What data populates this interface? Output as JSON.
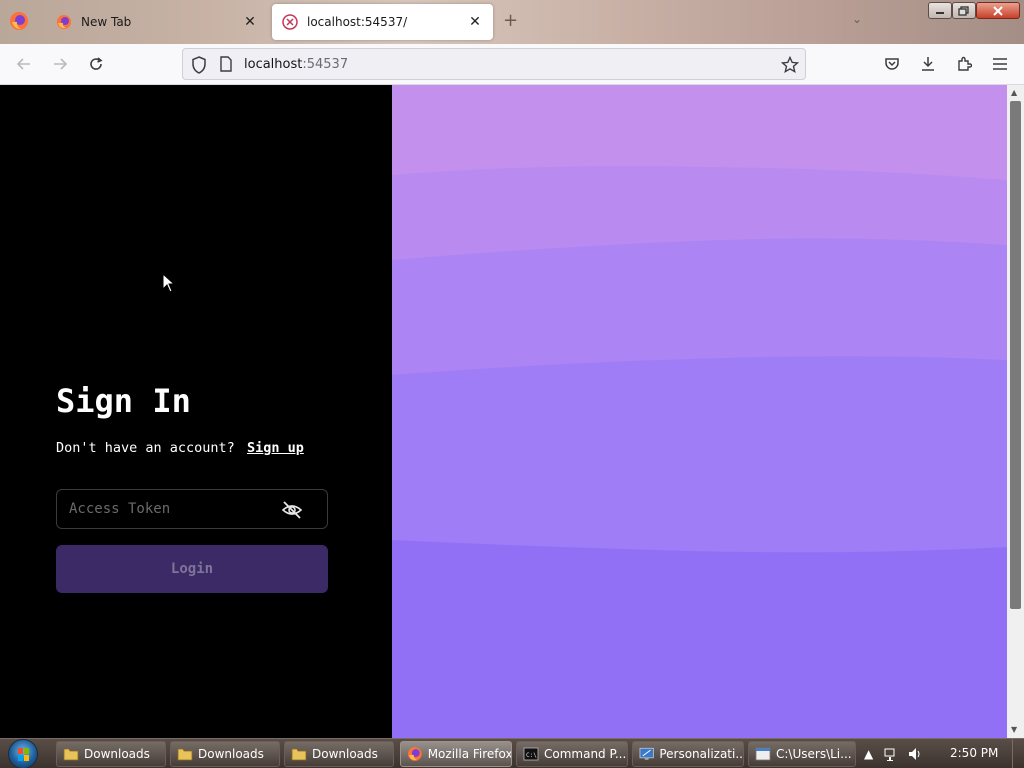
{
  "browser": {
    "tabs": [
      {
        "title": "New Tab",
        "active": false
      },
      {
        "title": "localhost:54537/",
        "active": true
      }
    ],
    "url": {
      "host": "localhost",
      "port": ":54537"
    }
  },
  "signin": {
    "title": "Sign In",
    "prompt": "Don't have an account?",
    "signup_link": "Sign up",
    "token_placeholder": "Access Token",
    "token_value": "",
    "login_label": "Login"
  },
  "colors": {
    "panel_bg": "#000000",
    "accent_button": "#3b2a66",
    "wave_bands": [
      "#c490ee",
      "#b98bf0",
      "#ac84f3",
      "#9f7df6",
      "#9170f6"
    ]
  },
  "taskbar": {
    "items": [
      {
        "label": "Downloads",
        "icon": "folder-icon",
        "active": false
      },
      {
        "label": "Downloads",
        "icon": "folder-icon",
        "active": false
      },
      {
        "label": "Downloads",
        "icon": "folder-icon",
        "active": false
      },
      {
        "label": "Mozilla Firefox",
        "icon": "firefox-icon",
        "active": true
      },
      {
        "label": "Command P...",
        "icon": "cmd-icon",
        "active": false
      },
      {
        "label": "Personalizati...",
        "icon": "personalization-icon",
        "active": false
      },
      {
        "label": "C:\\Users\\Li...",
        "icon": "window-icon",
        "active": false
      }
    ],
    "clock": "2:50 PM"
  }
}
